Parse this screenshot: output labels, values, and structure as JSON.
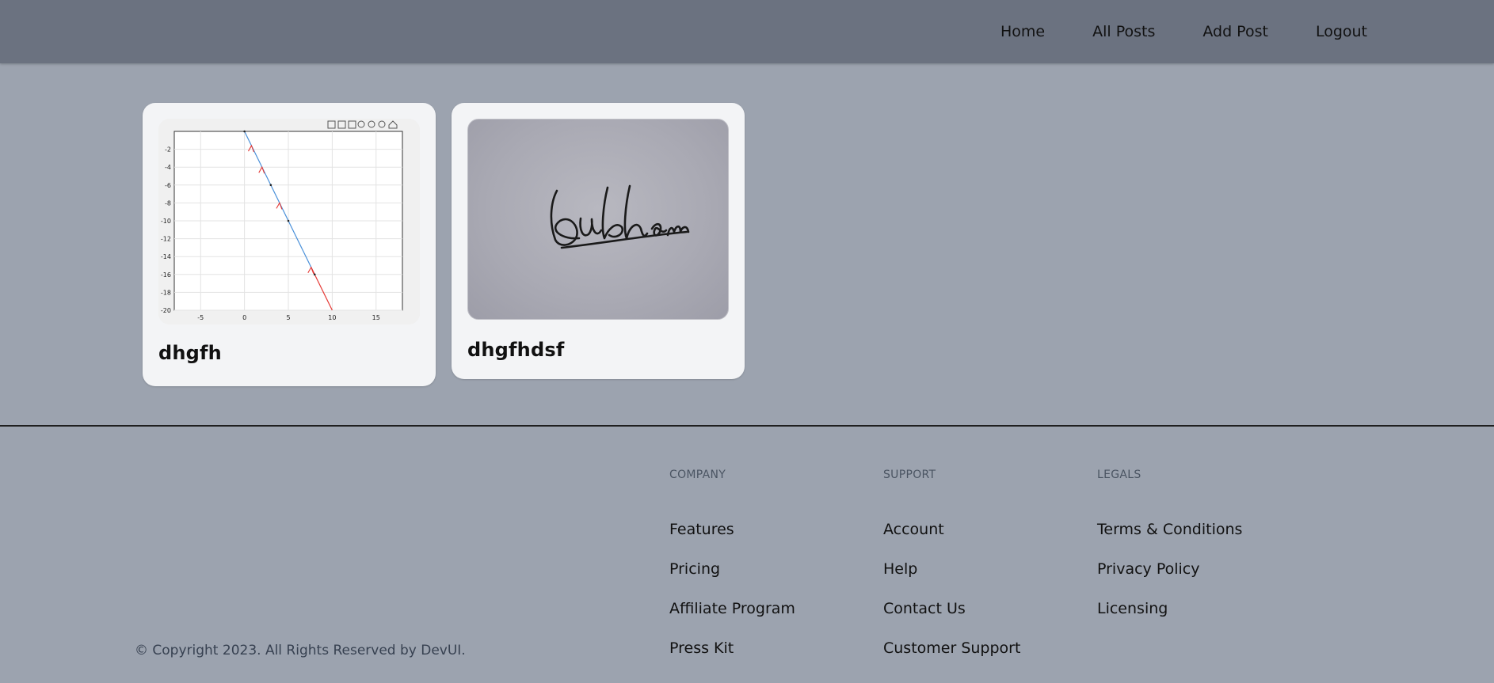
{
  "nav": {
    "items": [
      "Home",
      "All Posts",
      "Add Post",
      "Logout"
    ]
  },
  "posts": [
    {
      "title": "dhgfh",
      "thumbnail": {
        "kind": "plot-screenshot",
        "y_ticks": [
          "-2",
          "-4",
          "-6",
          "-8",
          "-10",
          "-12",
          "-14",
          "-16",
          "-18",
          "-20"
        ],
        "x_ticks": [
          "-5",
          "0",
          "5",
          "10",
          "15"
        ]
      }
    },
    {
      "title": "dhgfhdsf",
      "thumbnail": {
        "kind": "handwritten-signature-photo",
        "text": "Subham"
      }
    }
  ],
  "footer": {
    "columns": [
      {
        "heading": "COMPANY",
        "links": [
          "Features",
          "Pricing",
          "Affiliate Program",
          "Press Kit"
        ]
      },
      {
        "heading": "SUPPORT",
        "links": [
          "Account",
          "Help",
          "Contact Us",
          "Customer Support"
        ]
      },
      {
        "heading": "LEGALS",
        "links": [
          "Terms & Conditions",
          "Privacy Policy",
          "Licensing"
        ]
      }
    ],
    "copyright": "© Copyright 2023. All Rights Reserved by DevUI."
  },
  "colors": {
    "header_bg": "#6b7280",
    "page_bg": "#9ca3af",
    "card_bg": "#f3f4f6",
    "plot_line": "#4a90d9",
    "plot_arrows": "#e53935"
  }
}
